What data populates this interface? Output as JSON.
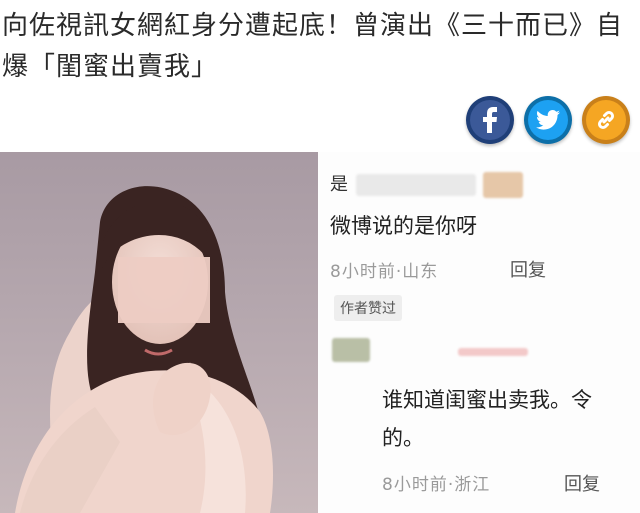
{
  "article": {
    "headline": "向佐視訊女網紅身分遭起底！曾演出《三十而已》自\n爆「閨蜜出賣我」"
  },
  "share": {
    "buttons": [
      {
        "name": "facebook-share-button",
        "icon": "facebook-icon",
        "glyph": "f",
        "color": "#3b5998"
      },
      {
        "name": "twitter-share-button",
        "icon": "twitter-icon",
        "glyph": "🐦",
        "color": "#1da1f2"
      },
      {
        "name": "link-share-button",
        "icon": "link-icon",
        "glyph": "🔗",
        "color": "#f5a623"
      }
    ]
  },
  "comments": [
    {
      "user_initial": "是",
      "text": "微博说的是你呀",
      "time": "8小时前",
      "location": "山东",
      "meta": "8小时前·山东",
      "reply_label": "回复",
      "badge": "作者赞过"
    },
    {
      "text_line1": "谁知道闺蜜出卖我。令",
      "text_line2": "的。",
      "time": "8小时前",
      "location": "浙江",
      "meta": "8小时前·浙江",
      "reply_label": "回复"
    }
  ],
  "colors": {
    "facebook": "#3b5998",
    "twitter": "#1da1f2",
    "link": "#f5a623"
  }
}
